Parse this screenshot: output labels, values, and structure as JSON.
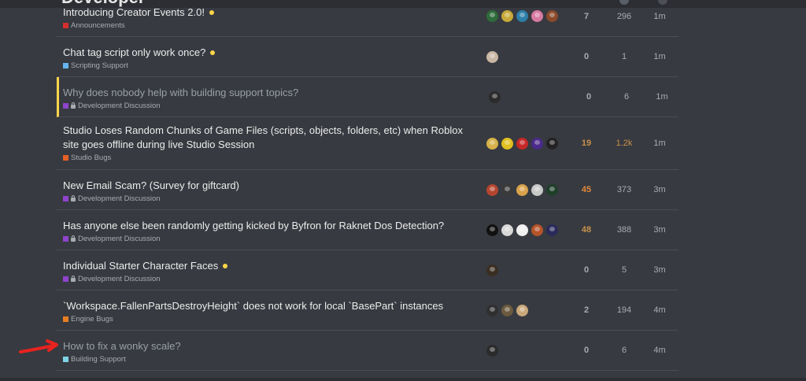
{
  "header": {
    "brand": "Developer"
  },
  "colors": {
    "announcements": "#d32f2f",
    "scripting_support": "#66b5f0",
    "development_discussion": "#8e44cc",
    "studio_bugs": "#e65f25",
    "engine_bugs": "#e67e22",
    "building_support": "#7fd3e6",
    "new_dot": "#ffd54a",
    "highlight_border": "#ffd54a",
    "hot_count": "#e1883a",
    "warm_count": "#c8914c",
    "annotation_arrow": "#e8231f"
  },
  "topics": [
    {
      "title": "Introducing Creator Events 2.0!",
      "category": "Announcements",
      "locked": false,
      "new": true,
      "read": false,
      "replies": "7",
      "views": "296",
      "activity": "1m",
      "avatar_count": 5,
      "heat": ""
    },
    {
      "title": "Chat tag script only work once?",
      "category": "Scripting Support",
      "locked": false,
      "new": true,
      "read": false,
      "replies": "0",
      "views": "1",
      "activity": "1m",
      "avatar_count": 1,
      "heat": ""
    },
    {
      "title": "Why does nobody help with building support topics?",
      "category": "Development Discussion",
      "locked": true,
      "new": false,
      "read": true,
      "replies": "0",
      "views": "6",
      "activity": "1m",
      "avatar_count": 1,
      "heat": "",
      "highlight": true
    },
    {
      "title": "Studio Loses Random Chunks of Game Files (scripts, objects, folders, etc) when Roblox site goes offline during live Studio Session",
      "category": "Studio Bugs",
      "locked": false,
      "new": false,
      "read": false,
      "replies": "19",
      "views": "1.2k",
      "activity": "1m",
      "avatar_count": 5,
      "heat": "warm"
    },
    {
      "title": "New Email Scam? (Survey for giftcard)",
      "category": "Development Discussion",
      "locked": true,
      "new": false,
      "read": false,
      "replies": "45",
      "views": "373",
      "activity": "3m",
      "avatar_count": 5,
      "heat": "hot"
    },
    {
      "title": "Has anyone else been randomly getting kicked by Byfron for Raknet Dos Detection?",
      "category": "Development Discussion",
      "locked": true,
      "new": false,
      "read": false,
      "replies": "48",
      "views": "388",
      "activity": "3m",
      "avatar_count": 5,
      "heat": "warm"
    },
    {
      "title": "Individual Starter Character Faces",
      "category": "Development Discussion",
      "locked": true,
      "new": true,
      "read": false,
      "replies": "0",
      "views": "5",
      "activity": "3m",
      "avatar_count": 1,
      "heat": ""
    },
    {
      "title": "`Workspace.FallenPartsDestroyHeight` does not work for local `BasePart` instances",
      "category": "Engine Bugs",
      "locked": false,
      "new": false,
      "read": false,
      "replies": "2",
      "views": "194",
      "activity": "4m",
      "avatar_count": 3,
      "heat": ""
    },
    {
      "title": "How to fix a wonky scale?",
      "category": "Building Support",
      "locked": false,
      "new": false,
      "read": true,
      "replies": "0",
      "views": "6",
      "activity": "4m",
      "avatar_count": 1,
      "heat": ""
    }
  ]
}
